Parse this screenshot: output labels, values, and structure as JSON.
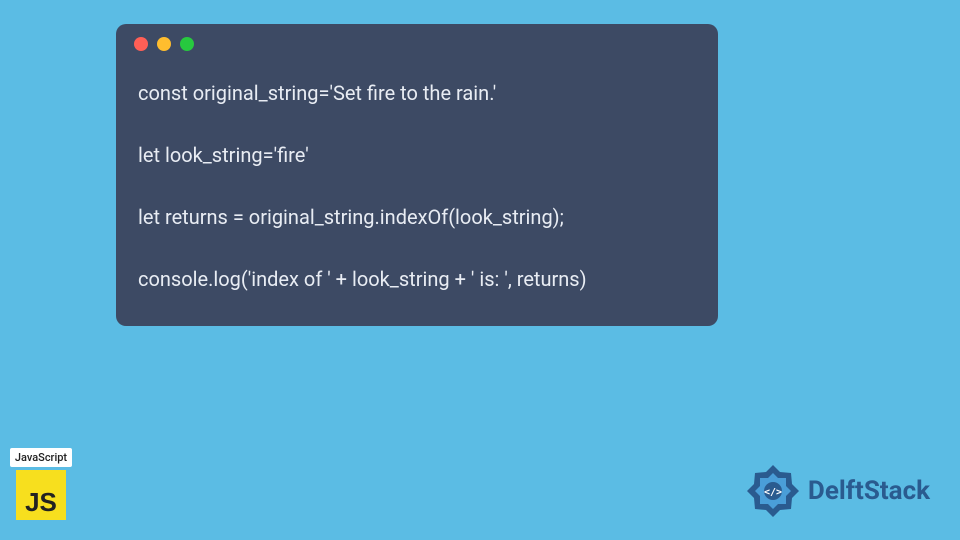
{
  "code": {
    "line1": "const original_string='Set fire to the rain.'",
    "line2": "let look_string='fire'",
    "line3": "let returns = original_string.indexOf(look_string);",
    "line4": "console.log('index of ' + look_string + ' is: ', returns)"
  },
  "js_badge": {
    "label": "JavaScript",
    "icon_text": "JS"
  },
  "brand": {
    "name": "DelftStack"
  }
}
